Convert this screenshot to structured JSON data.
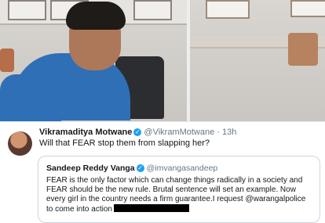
{
  "photo": {
    "description_icon": "person-photo"
  },
  "tweet": {
    "author_name": "Vikramaditya Motwane",
    "author_handle": "@VikramMotwane",
    "time": "· 13h",
    "text": "Will that FEAR stop them from slapping her?"
  },
  "quote": {
    "author_name": "Sandeep Reddy Vanga",
    "author_handle": "@imvangasandeep",
    "text": "FEAR is the only factor which can change things radically in a society and FEAR should be the new rule. Brutal sentence will set an example. Now every girl in the country needs a firm guarantee.I request @warangalpolice to come into action"
  },
  "icons": {
    "verified": "✓"
  },
  "colors": {
    "verified": "#1da1f2",
    "text": "#14171a",
    "muted": "#657786"
  }
}
